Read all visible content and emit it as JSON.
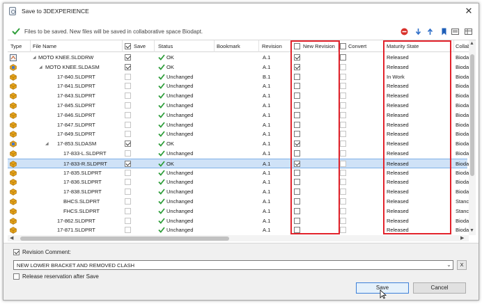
{
  "window": {
    "title": "Save to 3DEXPERIENCE",
    "close_glyph": "✕"
  },
  "info": {
    "text": "Files to be saved. New files will be saved in collaborative space Biodapt."
  },
  "toolbar_icons": [
    "no-entry-icon",
    "arrow-down-icon",
    "arrow-up-icon",
    "bookmark-icon",
    "list-view-icon",
    "table-view-icon"
  ],
  "columns": {
    "type": "Type",
    "file_name": "File Name",
    "save": "Save",
    "status": "Status",
    "bookmark": "Bookmark",
    "revision": "Revision",
    "new_revision": "New Revision",
    "convert": "Convert",
    "maturity_state": "Maturity State",
    "collab": "Collab"
  },
  "rows": [
    {
      "icon": "drawing-icon",
      "name": "MOTO KNEE.SLDDRW",
      "tree": "◢",
      "indent": 0,
      "save": true,
      "save_enabled": true,
      "status": "OK",
      "status_ok": true,
      "revision": "A.1",
      "new_revision": true,
      "nr_enabled": true,
      "convert_enabled": true,
      "maturity": "Released",
      "collab": "Bioda"
    },
    {
      "icon": "assembly-icon",
      "name": "MOTO KNEE.SLDASM",
      "tree": "◢",
      "indent": 1,
      "save": true,
      "save_enabled": true,
      "status": "OK",
      "status_ok": true,
      "revision": "A.1",
      "new_revision": true,
      "nr_enabled": true,
      "convert_enabled": false,
      "maturity": "Released",
      "collab": "Bioda"
    },
    {
      "icon": "part-icon",
      "name": "17-840.SLDPRT",
      "tree": "",
      "indent": 2,
      "save": false,
      "save_enabled": false,
      "status": "Unchanged",
      "status_ok": false,
      "revision": "B.1",
      "new_revision": false,
      "nr_enabled": true,
      "convert_enabled": false,
      "maturity": "In Work",
      "collab": "Bioda"
    },
    {
      "icon": "part-icon",
      "name": "17-841.SLDPRT",
      "tree": "",
      "indent": 2,
      "save": false,
      "save_enabled": false,
      "status": "Unchanged",
      "status_ok": false,
      "revision": "A.1",
      "new_revision": false,
      "nr_enabled": true,
      "convert_enabled": false,
      "maturity": "Released",
      "collab": "Bioda"
    },
    {
      "icon": "part-icon",
      "name": "17-843.SLDPRT",
      "tree": "",
      "indent": 2,
      "save": false,
      "save_enabled": false,
      "status": "Unchanged",
      "status_ok": false,
      "revision": "A.1",
      "new_revision": false,
      "nr_enabled": true,
      "convert_enabled": false,
      "maturity": "Released",
      "collab": "Bioda"
    },
    {
      "icon": "part-icon",
      "name": "17-845.SLDPRT",
      "tree": "",
      "indent": 2,
      "save": false,
      "save_enabled": false,
      "status": "Unchanged",
      "status_ok": false,
      "revision": "A.1",
      "new_revision": false,
      "nr_enabled": true,
      "convert_enabled": false,
      "maturity": "Released",
      "collab": "Bioda"
    },
    {
      "icon": "part-icon",
      "name": "17-846.SLDPRT",
      "tree": "",
      "indent": 2,
      "save": false,
      "save_enabled": false,
      "status": "Unchanged",
      "status_ok": false,
      "revision": "A.1",
      "new_revision": false,
      "nr_enabled": true,
      "convert_enabled": false,
      "maturity": "Released",
      "collab": "Bioda"
    },
    {
      "icon": "part-icon",
      "name": "17-847.SLDPRT",
      "tree": "",
      "indent": 2,
      "save": false,
      "save_enabled": false,
      "status": "Unchanged",
      "status_ok": false,
      "revision": "A.1",
      "new_revision": false,
      "nr_enabled": true,
      "convert_enabled": false,
      "maturity": "Released",
      "collab": "Bioda"
    },
    {
      "icon": "part-icon",
      "name": "17-849.SLDPRT",
      "tree": "",
      "indent": 2,
      "save": false,
      "save_enabled": false,
      "status": "Unchanged",
      "status_ok": false,
      "revision": "A.1",
      "new_revision": false,
      "nr_enabled": true,
      "convert_enabled": false,
      "maturity": "Released",
      "collab": "Bioda"
    },
    {
      "icon": "assembly-icon",
      "name": "17-853.SLDASM",
      "tree": "◢",
      "indent": 2,
      "save": true,
      "save_enabled": true,
      "status": "OK",
      "status_ok": true,
      "revision": "A.1",
      "new_revision": true,
      "nr_enabled": true,
      "convert_enabled": false,
      "maturity": "Released",
      "collab": "Bioda"
    },
    {
      "icon": "part-icon",
      "name": "17-833-L.SLDPRT",
      "tree": "",
      "indent": 3,
      "save": false,
      "save_enabled": false,
      "status": "Unchanged",
      "status_ok": false,
      "revision": "A.1",
      "new_revision": false,
      "nr_enabled": true,
      "convert_enabled": false,
      "maturity": "Released",
      "collab": "Bioda"
    },
    {
      "icon": "part-icon",
      "name": "17-833-R.SLDPRT",
      "tree": "",
      "indent": 3,
      "save": true,
      "save_enabled": true,
      "status": "OK",
      "status_ok": true,
      "revision": "A.1",
      "new_revision": true,
      "nr_enabled": true,
      "convert_enabled": false,
      "maturity": "Released",
      "collab": "Bioda",
      "selected": true
    },
    {
      "icon": "part-icon",
      "name": "17-835.SLDPRT",
      "tree": "",
      "indent": 3,
      "save": false,
      "save_enabled": false,
      "status": "Unchanged",
      "status_ok": false,
      "revision": "A.1",
      "new_revision": false,
      "nr_enabled": true,
      "convert_enabled": false,
      "maturity": "Released",
      "collab": "Bioda"
    },
    {
      "icon": "part-icon",
      "name": "17-836.SLDPRT",
      "tree": "",
      "indent": 3,
      "save": false,
      "save_enabled": false,
      "status": "Unchanged",
      "status_ok": false,
      "revision": "A.1",
      "new_revision": false,
      "nr_enabled": true,
      "convert_enabled": false,
      "maturity": "Released",
      "collab": "Bioda"
    },
    {
      "icon": "part-icon",
      "name": "17-838.SLDPRT",
      "tree": "",
      "indent": 3,
      "save": false,
      "save_enabled": false,
      "status": "Unchanged",
      "status_ok": false,
      "revision": "A.1",
      "new_revision": false,
      "nr_enabled": true,
      "convert_enabled": false,
      "maturity": "Released",
      "collab": "Bioda"
    },
    {
      "icon": "part-icon",
      "name": "BHCS.SLDPRT",
      "tree": "",
      "indent": 3,
      "save": false,
      "save_enabled": false,
      "status": "Unchanged",
      "status_ok": false,
      "revision": "A.1",
      "new_revision": false,
      "nr_enabled": true,
      "convert_enabled": false,
      "maturity": "Released",
      "collab": "Stanc"
    },
    {
      "icon": "part-icon",
      "name": "FHCS.SLDPRT",
      "tree": "",
      "indent": 3,
      "save": false,
      "save_enabled": false,
      "status": "Unchanged",
      "status_ok": false,
      "revision": "A.1",
      "new_revision": false,
      "nr_enabled": true,
      "convert_enabled": false,
      "maturity": "Released",
      "collab": "Stanc"
    },
    {
      "icon": "part-icon",
      "name": "17-862.SLDPRT",
      "tree": "",
      "indent": 2,
      "save": false,
      "save_enabled": false,
      "status": "Unchanged",
      "status_ok": false,
      "revision": "A.1",
      "new_revision": false,
      "nr_enabled": true,
      "convert_enabled": false,
      "maturity": "Released",
      "collab": "Bioda"
    },
    {
      "icon": "part-icon",
      "name": "17-871.SLDPRT",
      "tree": "",
      "indent": 2,
      "save": false,
      "save_enabled": false,
      "status": "Unchanged",
      "status_ok": false,
      "revision": "A.1",
      "new_revision": false,
      "nr_enabled": true,
      "convert_enabled": false,
      "maturity": "Released",
      "collab": "Bioda"
    }
  ],
  "bottom": {
    "revision_comment_label": "Revision Comment:",
    "revision_comment_checked": true,
    "revision_comment_value": "NEW LOWER BRACKET AND REMOVED CLASH",
    "clear_label": "X",
    "release_label": "Release reservation after Save",
    "release_checked": false,
    "save_label": "Save",
    "cancel_label": "Cancel"
  },
  "colors": {
    "highlight_box": "#e2222b",
    "ok_green": "#2e9e3a",
    "selection": "#cfe2f7",
    "part_icon": "#e3a21a"
  }
}
